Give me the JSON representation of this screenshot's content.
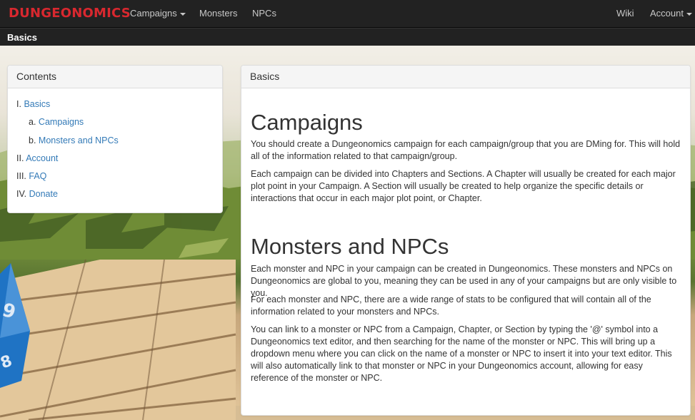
{
  "navbar": {
    "brand": "DUNGEONOMICS",
    "items": [
      {
        "label": "Campaigns"
      },
      {
        "label": "Monsters"
      },
      {
        "label": "NPCs"
      }
    ],
    "right": [
      {
        "label": "Wiki"
      },
      {
        "label": "Account"
      }
    ]
  },
  "breadcrumb": {
    "title": "Basics"
  },
  "toc": {
    "heading": "Contents",
    "items": [
      {
        "num": "I.",
        "label": "Basics"
      },
      {
        "num": "a.",
        "label": "Campaigns"
      },
      {
        "num": "b.",
        "label": "Monsters and NPCs"
      },
      {
        "num": "II.",
        "label": "Account"
      },
      {
        "num": "III.",
        "label": "FAQ"
      },
      {
        "num": "IV.",
        "label": "Donate"
      }
    ]
  },
  "main": {
    "heading": "Basics",
    "sections": [
      {
        "title": "Campaigns",
        "paragraphs": [
          "You should create a Dungeonomics campaign for each campaign/group that you are DMing for. This will hold all of the information related to that campaign/group.",
          "Each campaign can be divided into Chapters and Sections. A Chapter will usually be created for each major plot point in your Campaign. A Section will usually be created to help organize the specific details or interactions that occur in each major plot point, or Chapter."
        ]
      },
      {
        "title": "Monsters and NPCs",
        "paragraphs": [
          "Each monster and NPC in your campaign can be created in Dungeonomics. These monsters and NPCs on Dungeonomics are global to you, meaning they can be used in any of your campaigns but are only visible to you.",
          "For each monster and NPC, there are a wide range of stats to be configured that will contain all of the information related to your monsters and NPCs.",
          "You can link to a monster or NPC from a Campaign, Chapter, or Section by typing the '@' symbol into a Dungeonomics text editor, and then searching for the name of the monster or NPC. This will bring up a dropdown menu where you can click on the name of a monster or NPC to insert it into your text editor. This will also automatically link to that monster or NPC in your Dungeonomics account, allowing for easy reference of the monster or NPC."
        ]
      }
    ]
  },
  "colors": {
    "brand": "#d9282f",
    "navbar": "#222222",
    "link": "#337ab7",
    "die": "#1f73c4"
  }
}
